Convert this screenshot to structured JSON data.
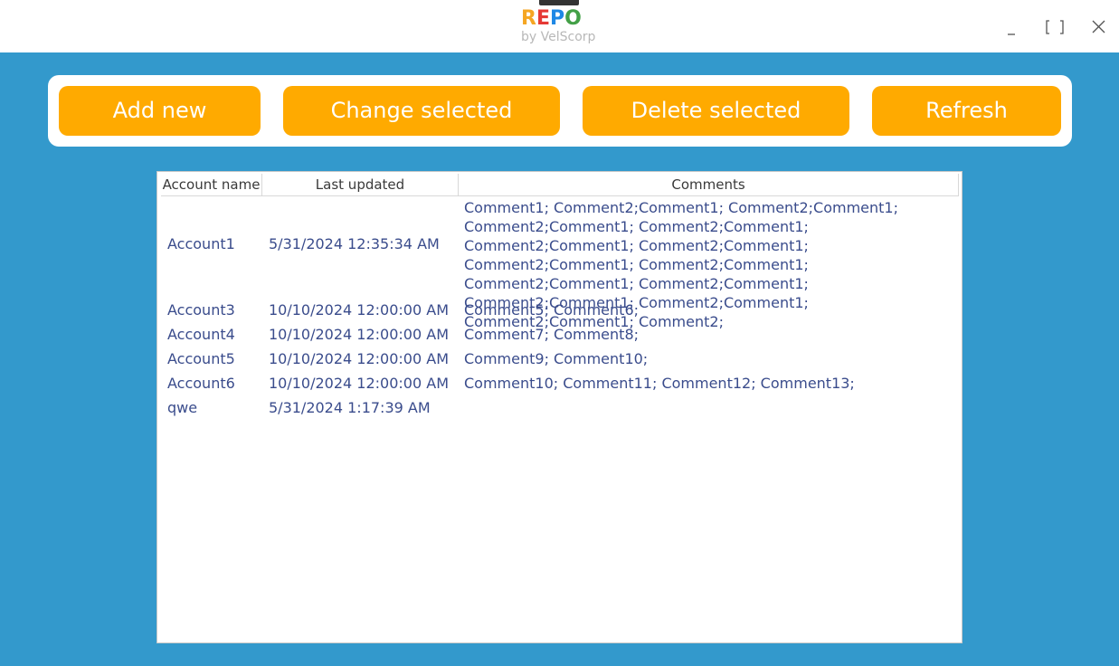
{
  "app": {
    "logo_letters": [
      {
        "char": "R",
        "color": "#f5a623"
      },
      {
        "char": "E",
        "color": "#e53935"
      },
      {
        "char": "P",
        "color": "#1e88e5"
      },
      {
        "char": "O",
        "color": "#43a047"
      }
    ],
    "logo_subtitle": "by VelScorp"
  },
  "window_controls": {
    "minimize": "_",
    "maximize": "[ ]",
    "close": "✕"
  },
  "toolbar": {
    "add_label": "Add new",
    "change_label": "Change selected",
    "delete_label": "Delete selected",
    "refresh_label": "Refresh"
  },
  "colors": {
    "background": "#3399cc",
    "button": "#ffaa00",
    "cell_text": "#3a4c8c"
  },
  "table": {
    "columns": [
      "Account name",
      "Last updated",
      "Comments"
    ],
    "rows": [
      {
        "account": "Account1",
        "updated": "5/31/2024 12:35:34 AM",
        "comments": "Comment1; Comment2;Comment1; Comment2;Comment1; Comment2;Comment1; Comment2;Comment1; Comment2;Comment1; Comment2;Comment1; Comment2;Comment1; Comment2;Comment1; Comment2;Comment1; Comment2;Comment1; Comment2;Comment1; Comment2;Comment1; Comment2;Comment1; Comment2;"
      },
      {
        "account": "Account3",
        "updated": "10/10/2024 12:00:00 AM",
        "comments": "Comment5; Comment6;"
      },
      {
        "account": "Account4",
        "updated": "10/10/2024 12:00:00 AM",
        "comments": "Comment7; Comment8;"
      },
      {
        "account": "Account5",
        "updated": "10/10/2024 12:00:00 AM",
        "comments": "Comment9; Comment10;"
      },
      {
        "account": "Account6",
        "updated": "10/10/2024 12:00:00 AM",
        "comments": "Comment10; Comment11; Comment12; Comment13;"
      },
      {
        "account": "qwe",
        "updated": "5/31/2024 1:17:39 AM",
        "comments": ""
      }
    ]
  }
}
